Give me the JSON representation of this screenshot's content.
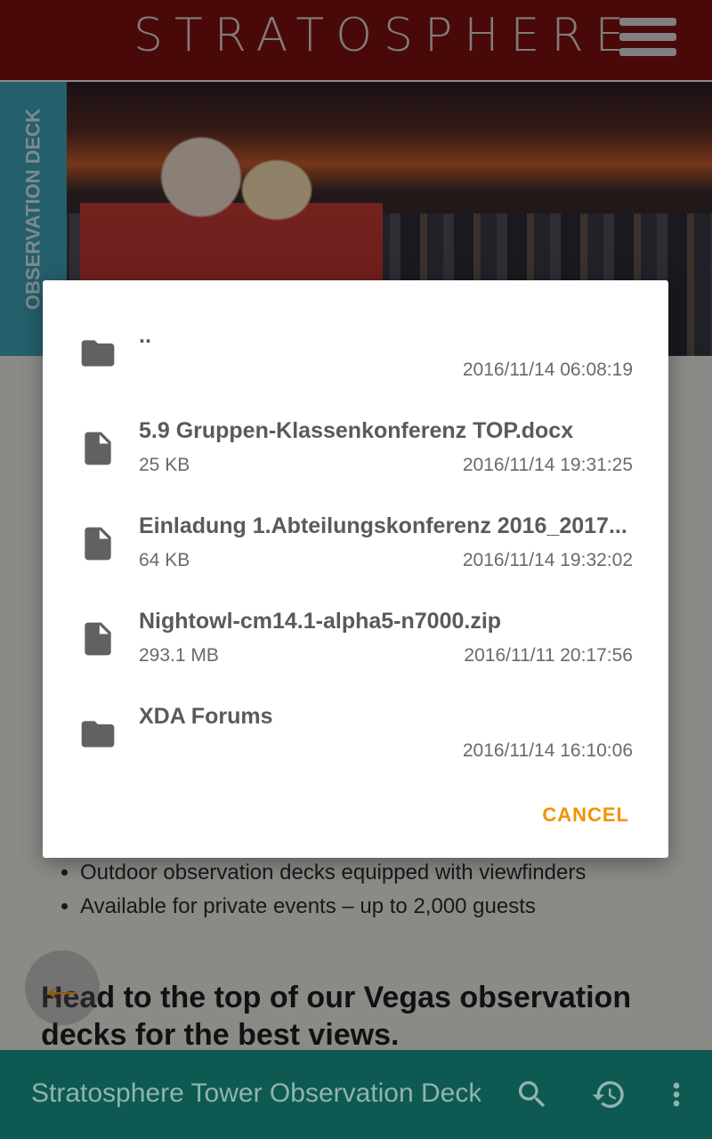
{
  "header": {
    "brand": "STRATOSPHERE",
    "menu_icon": "hamburger-menu-icon"
  },
  "hero": {
    "side_tab": "OBSERVATION DECK"
  },
  "content": {
    "bullets": [
      "Outdoor observation decks equipped with viewfinders",
      "Available for private events – up to 2,000 guests"
    ],
    "headline": "Head to the top of our Vegas observation decks for the best views.",
    "fab_icon": "arrow-left-icon"
  },
  "dialog": {
    "items": [
      {
        "type": "folder",
        "name": "..",
        "size": "",
        "date": "2016/11/14 06:08:19"
      },
      {
        "type": "file",
        "name": "5.9 Gruppen-Klassenkonferenz TOP.docx",
        "size": "25 KB",
        "date": "2016/11/14 19:31:25"
      },
      {
        "type": "file",
        "name": "Einladung 1.Abteilungskonferenz 2016_2017...",
        "size": "64 KB",
        "date": "2016/11/14 19:32:02"
      },
      {
        "type": "file",
        "name": "Nightowl-cm14.1-alpha5-n7000.zip",
        "size": "293.1 MB",
        "date": "2016/11/11 20:17:56"
      },
      {
        "type": "folder",
        "name": "XDA Forums",
        "size": "",
        "date": "2016/11/14 16:10:06"
      }
    ],
    "cancel_label": "CANCEL",
    "accent": "#f39200"
  },
  "bottom_bar": {
    "title": "Stratosphere Tower Observation Deck",
    "icons": [
      "search-icon",
      "history-icon",
      "more-vert-icon"
    ],
    "color": "#0e5a52"
  }
}
